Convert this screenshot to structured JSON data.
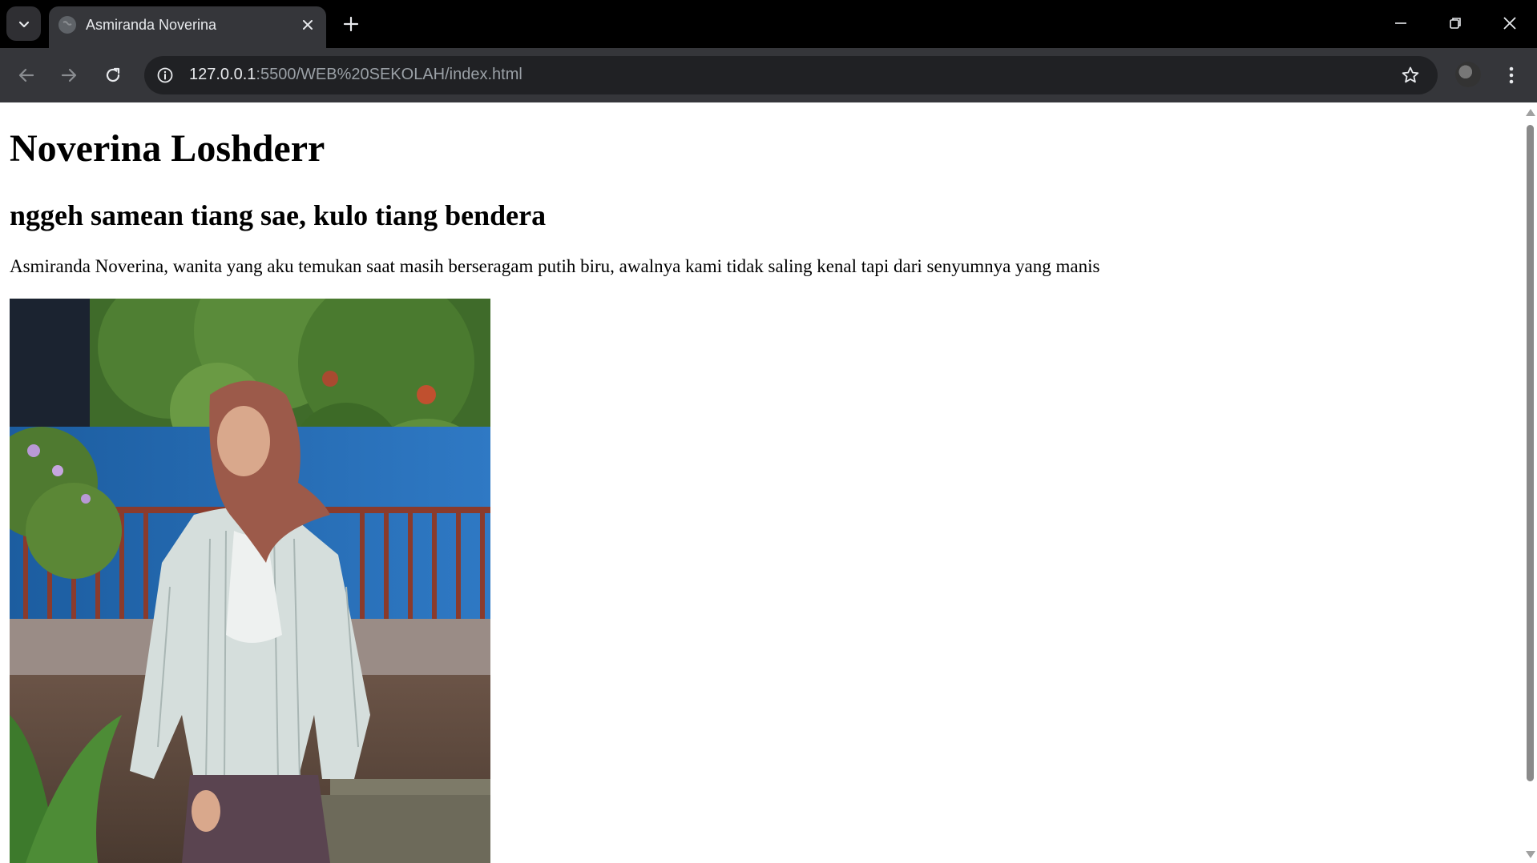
{
  "browser": {
    "tab": {
      "title": "Asmiranda Noverina"
    },
    "address": {
      "host": "127.0.0.1",
      "path": ":5500/WEB%20SEKOLAH/index.html"
    },
    "icons": {
      "tab_search": "chevron-down-icon",
      "favicon": "globe-icon",
      "tab_close": "close-icon",
      "new_tab": "plus-icon",
      "minimize": "minimize-icon",
      "restore": "restore-icon",
      "close_window": "close-icon",
      "back": "arrow-left-icon",
      "forward": "arrow-right-icon",
      "reload": "reload-icon",
      "site_info": "info-icon",
      "bookmark": "star-icon",
      "profile": "avatar",
      "menu": "kebab-menu-icon"
    }
  },
  "page": {
    "heading": "Noverina Loshderr",
    "subheading": "nggeh samean tiang sae, kulo tiang bendera",
    "paragraph": "Asmiranda Noverina, wanita yang aku temukan saat masih berseragam putih biru, awalnya kami tidak saling kenal tapi dari senyumnya yang manis"
  },
  "colors": {
    "tabstrip": "#000000",
    "toolbar": "#35363a",
    "omnibox": "#202124",
    "page_bg": "#ffffff"
  }
}
